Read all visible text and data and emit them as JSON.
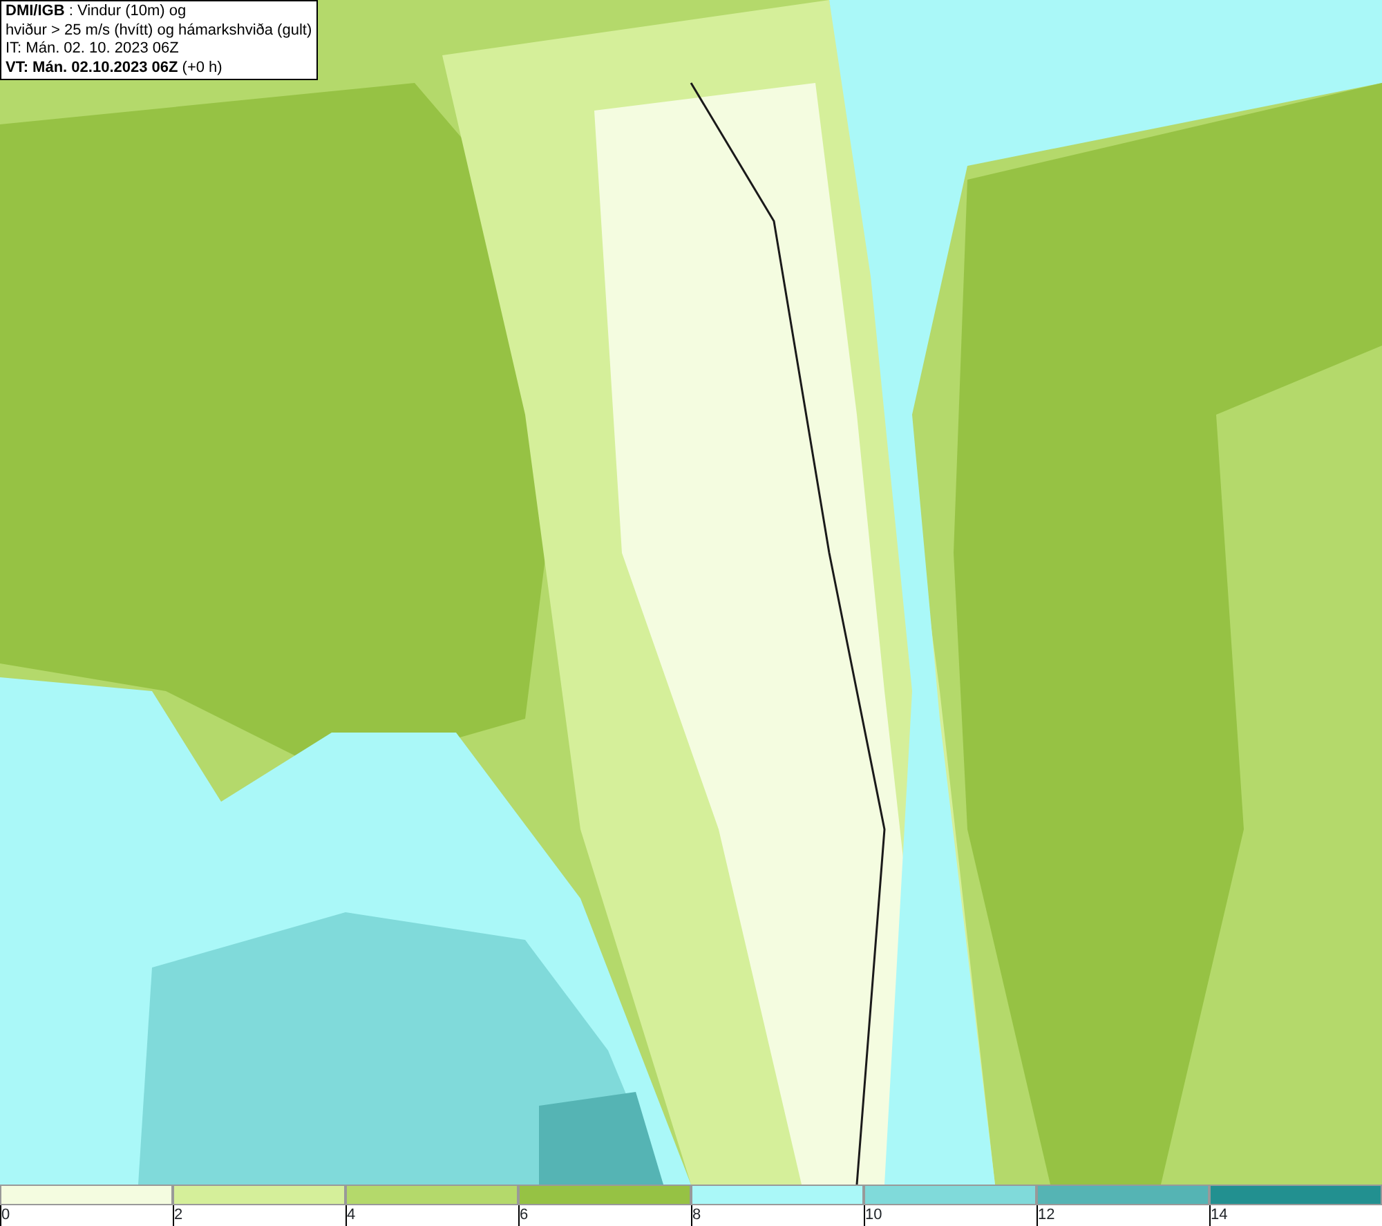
{
  "header": {
    "lines": [
      "**DMI/IGB** : Vindur (10m) og",
      "hviður > 25 m/s (hvítt) og hámarkshviða (gult)",
      "IT: Mán. 02. 10. 2023 06Z",
      "**VT: Mán. 02.10.2023 06Z** (+0 h)"
    ]
  },
  "legend": {
    "segments": [
      {
        "color": "#f4fce0",
        "tick": "0"
      },
      {
        "color": "#d5ef9a",
        "tick": "2"
      },
      {
        "color": "#b4d96b",
        "tick": "4"
      },
      {
        "color": "#96c244",
        "tick": "6"
      },
      {
        "color": "#aaf8f8",
        "tick": "8"
      },
      {
        "color": "#80dada",
        "tick": "10"
      },
      {
        "color": "#55b4b4",
        "tick": "12"
      },
      {
        "color": "#229090",
        "tick": "14"
      }
    ]
  }
}
